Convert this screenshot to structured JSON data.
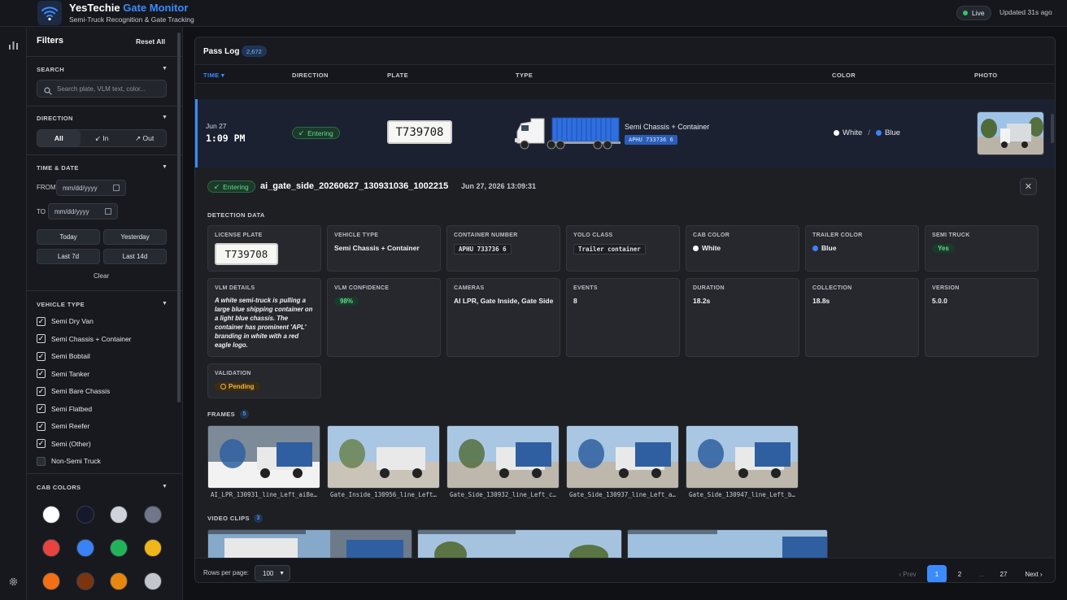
{
  "app": {
    "title_main": "YesTechie",
    "title_accent": "Gate Monitor",
    "subtitle": "Semi-Truck Recognition & Gate Tracking",
    "live_label": "Live",
    "updated": "Updated 31s ago"
  },
  "sidebar": {
    "title": "Filters",
    "reset": "Reset All",
    "search": {
      "title": "SEARCH",
      "placeholder": "Search plate, VLM text, color..."
    },
    "direction": {
      "title": "DIRECTION",
      "options": [
        "All",
        "↙ In",
        "↗ Out"
      ],
      "selected": "All"
    },
    "time": {
      "title": "TIME & DATE",
      "from_label": "FROM",
      "to_label": "TO",
      "from_value": "mm/dd/yyyy",
      "to_value": "mm/dd/yyyy",
      "quick": [
        "Today",
        "Yesterday",
        "Last 7d",
        "Last 14d"
      ],
      "clear": "Clear"
    },
    "vehicle_type": {
      "title": "VEHICLE TYPE",
      "items": [
        {
          "label": "Semi Dry Van",
          "checked": true
        },
        {
          "label": "Semi Chassis + Container",
          "checked": true
        },
        {
          "label": "Semi Bobtail",
          "checked": true
        },
        {
          "label": "Semi Tanker",
          "checked": true
        },
        {
          "label": "Semi Bare Chassis",
          "checked": true
        },
        {
          "label": "Semi Flatbed",
          "checked": true
        },
        {
          "label": "Semi Reefer",
          "checked": true
        },
        {
          "label": "Semi (Other)",
          "checked": true
        },
        {
          "label": "Non-Semi Truck",
          "checked": false
        }
      ]
    },
    "cab_colors": {
      "title": "CAB COLORS",
      "swatches": [
        "#ffffff",
        "#141a2c",
        "#cfd2d8",
        "#6f7789",
        "#e8433f",
        "#3b82f6",
        "#22b35a",
        "#f2b51b",
        "#f26f16",
        "#7a3410",
        "#e8870f",
        "#c3c6cc"
      ]
    }
  },
  "passlog": {
    "title": "Pass Log",
    "count": "2,672",
    "columns": [
      "TIME ▾",
      "DIRECTION",
      "PLATE",
      "TYPE",
      "COLOR",
      "PHOTO"
    ],
    "row": {
      "date": "Jun 27",
      "time": "1:09 PM",
      "direction": "Entering",
      "plate": "T739708",
      "type": "Semi Chassis + Container",
      "container": "APHU 733736 6",
      "cab_color": "White",
      "trailer_color": "Blue",
      "color_sep": "/"
    }
  },
  "detail": {
    "direction": "Entering",
    "filename": "ai_gate_side_20260627_130931036_1002215",
    "timestamp": "Jun 27, 2026 13:09:31",
    "section_detection": "DETECTION DATA",
    "cards": {
      "license_plate": {
        "label": "LICENSE PLATE",
        "value": "T739708"
      },
      "vehicle_type": {
        "label": "VEHICLE TYPE",
        "value": "Semi Chassis + Container"
      },
      "container_number": {
        "label": "CONTAINER NUMBER",
        "value": "APHU 733736 6"
      },
      "yolo_class": {
        "label": "YOLO CLASS",
        "value": "Trailer container"
      },
      "cab_color": {
        "label": "CAB COLOR",
        "value": "White"
      },
      "trailer_color": {
        "label": "TRAILER COLOR",
        "value": "Blue"
      },
      "semi_truck": {
        "label": "SEMI TRUCK",
        "value": "Yes"
      },
      "vlm_details": {
        "label": "VLM DETAILS",
        "value": "A white semi-truck is pulling a large blue shipping container on a light blue chassis. The container has prominent 'APL' branding in white with a red eagle logo."
      },
      "vlm_confidence": {
        "label": "VLM CONFIDENCE",
        "value": "98%"
      },
      "cameras": {
        "label": "CAMERAS",
        "value": "AI LPR, Gate Inside, Gate Side"
      },
      "events": {
        "label": "EVENTS",
        "value": "8"
      },
      "duration": {
        "label": "DURATION",
        "value": "18.2s"
      },
      "collection": {
        "label": "COLLECTION",
        "value": "18.8s"
      },
      "version": {
        "label": "VERSION",
        "value": "5.0.0"
      },
      "validation": {
        "label": "VALIDATION",
        "value": "Pending"
      }
    },
    "frames": {
      "title": "FRAMES",
      "count": "5",
      "items": [
        "AI_LPR_130931_line_Left_ai8e…",
        "Gate_Inside_130956_line_Left…",
        "Gate_Side_130932_line_Left_c…",
        "Gate_Side_130937_line_Left_a…",
        "Gate_Side_130947_line_Left_b…"
      ]
    },
    "clips": {
      "title": "VIDEO CLIPS",
      "count": "3"
    }
  },
  "footer": {
    "rows_label": "Rows per page:",
    "rows_value": "100",
    "prev": "‹ Prev",
    "pages": [
      "1",
      "2",
      "...",
      "27"
    ],
    "current": "1",
    "next": "Next ›"
  }
}
